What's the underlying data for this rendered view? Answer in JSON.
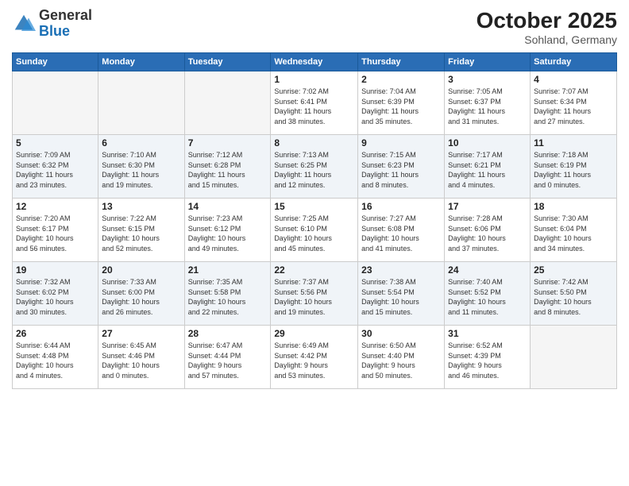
{
  "header": {
    "logo_line1": "General",
    "logo_line2": "Blue",
    "month": "October 2025",
    "location": "Sohland, Germany"
  },
  "weekdays": [
    "Sunday",
    "Monday",
    "Tuesday",
    "Wednesday",
    "Thursday",
    "Friday",
    "Saturday"
  ],
  "weeks": [
    [
      {
        "day": "",
        "info": ""
      },
      {
        "day": "",
        "info": ""
      },
      {
        "day": "",
        "info": ""
      },
      {
        "day": "1",
        "info": "Sunrise: 7:02 AM\nSunset: 6:41 PM\nDaylight: 11 hours\nand 38 minutes."
      },
      {
        "day": "2",
        "info": "Sunrise: 7:04 AM\nSunset: 6:39 PM\nDaylight: 11 hours\nand 35 minutes."
      },
      {
        "day": "3",
        "info": "Sunrise: 7:05 AM\nSunset: 6:37 PM\nDaylight: 11 hours\nand 31 minutes."
      },
      {
        "day": "4",
        "info": "Sunrise: 7:07 AM\nSunset: 6:34 PM\nDaylight: 11 hours\nand 27 minutes."
      }
    ],
    [
      {
        "day": "5",
        "info": "Sunrise: 7:09 AM\nSunset: 6:32 PM\nDaylight: 11 hours\nand 23 minutes."
      },
      {
        "day": "6",
        "info": "Sunrise: 7:10 AM\nSunset: 6:30 PM\nDaylight: 11 hours\nand 19 minutes."
      },
      {
        "day": "7",
        "info": "Sunrise: 7:12 AM\nSunset: 6:28 PM\nDaylight: 11 hours\nand 15 minutes."
      },
      {
        "day": "8",
        "info": "Sunrise: 7:13 AM\nSunset: 6:25 PM\nDaylight: 11 hours\nand 12 minutes."
      },
      {
        "day": "9",
        "info": "Sunrise: 7:15 AM\nSunset: 6:23 PM\nDaylight: 11 hours\nand 8 minutes."
      },
      {
        "day": "10",
        "info": "Sunrise: 7:17 AM\nSunset: 6:21 PM\nDaylight: 11 hours\nand 4 minutes."
      },
      {
        "day": "11",
        "info": "Sunrise: 7:18 AM\nSunset: 6:19 PM\nDaylight: 11 hours\nand 0 minutes."
      }
    ],
    [
      {
        "day": "12",
        "info": "Sunrise: 7:20 AM\nSunset: 6:17 PM\nDaylight: 10 hours\nand 56 minutes."
      },
      {
        "day": "13",
        "info": "Sunrise: 7:22 AM\nSunset: 6:15 PM\nDaylight: 10 hours\nand 52 minutes."
      },
      {
        "day": "14",
        "info": "Sunrise: 7:23 AM\nSunset: 6:12 PM\nDaylight: 10 hours\nand 49 minutes."
      },
      {
        "day": "15",
        "info": "Sunrise: 7:25 AM\nSunset: 6:10 PM\nDaylight: 10 hours\nand 45 minutes."
      },
      {
        "day": "16",
        "info": "Sunrise: 7:27 AM\nSunset: 6:08 PM\nDaylight: 10 hours\nand 41 minutes."
      },
      {
        "day": "17",
        "info": "Sunrise: 7:28 AM\nSunset: 6:06 PM\nDaylight: 10 hours\nand 37 minutes."
      },
      {
        "day": "18",
        "info": "Sunrise: 7:30 AM\nSunset: 6:04 PM\nDaylight: 10 hours\nand 34 minutes."
      }
    ],
    [
      {
        "day": "19",
        "info": "Sunrise: 7:32 AM\nSunset: 6:02 PM\nDaylight: 10 hours\nand 30 minutes."
      },
      {
        "day": "20",
        "info": "Sunrise: 7:33 AM\nSunset: 6:00 PM\nDaylight: 10 hours\nand 26 minutes."
      },
      {
        "day": "21",
        "info": "Sunrise: 7:35 AM\nSunset: 5:58 PM\nDaylight: 10 hours\nand 22 minutes."
      },
      {
        "day": "22",
        "info": "Sunrise: 7:37 AM\nSunset: 5:56 PM\nDaylight: 10 hours\nand 19 minutes."
      },
      {
        "day": "23",
        "info": "Sunrise: 7:38 AM\nSunset: 5:54 PM\nDaylight: 10 hours\nand 15 minutes."
      },
      {
        "day": "24",
        "info": "Sunrise: 7:40 AM\nSunset: 5:52 PM\nDaylight: 10 hours\nand 11 minutes."
      },
      {
        "day": "25",
        "info": "Sunrise: 7:42 AM\nSunset: 5:50 PM\nDaylight: 10 hours\nand 8 minutes."
      }
    ],
    [
      {
        "day": "26",
        "info": "Sunrise: 6:44 AM\nSunset: 4:48 PM\nDaylight: 10 hours\nand 4 minutes."
      },
      {
        "day": "27",
        "info": "Sunrise: 6:45 AM\nSunset: 4:46 PM\nDaylight: 10 hours\nand 0 minutes."
      },
      {
        "day": "28",
        "info": "Sunrise: 6:47 AM\nSunset: 4:44 PM\nDaylight: 9 hours\nand 57 minutes."
      },
      {
        "day": "29",
        "info": "Sunrise: 6:49 AM\nSunset: 4:42 PM\nDaylight: 9 hours\nand 53 minutes."
      },
      {
        "day": "30",
        "info": "Sunrise: 6:50 AM\nSunset: 4:40 PM\nDaylight: 9 hours\nand 50 minutes."
      },
      {
        "day": "31",
        "info": "Sunrise: 6:52 AM\nSunset: 4:39 PM\nDaylight: 9 hours\nand 46 minutes."
      },
      {
        "day": "",
        "info": ""
      }
    ]
  ]
}
